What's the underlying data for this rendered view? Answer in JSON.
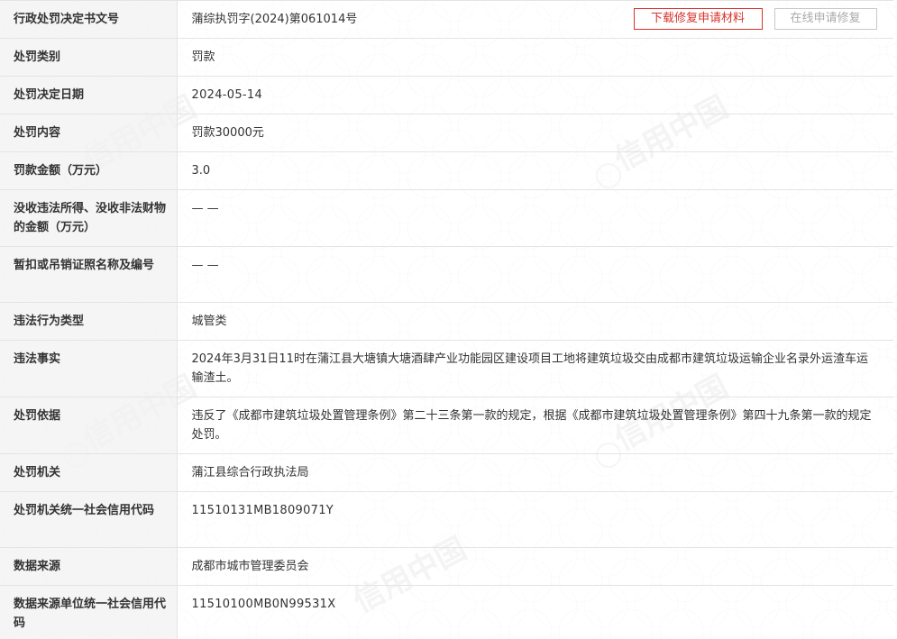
{
  "watermark_text": "信用中国",
  "actions": {
    "download_label": "下载修复申请材料",
    "online_label": "在线申请修复"
  },
  "rows": [
    {
      "label": "行政处罚决定书文号",
      "value": "蒲综执罚字(2024)第061014号"
    },
    {
      "label": "处罚类别",
      "value": "罚款"
    },
    {
      "label": "处罚决定日期",
      "value": "2024-05-14"
    },
    {
      "label": "处罚内容",
      "value": "罚款30000元"
    },
    {
      "label": "罚款金额（万元）",
      "value": "3.0"
    },
    {
      "label": "没收违法所得、没收非法财物的金额（万元）",
      "value": "— —"
    },
    {
      "label": "暂扣或吊销证照名称及编号",
      "value": "— —"
    },
    {
      "label": "违法行为类型",
      "value": "城管类"
    },
    {
      "label": "违法事实",
      "value": "2024年3月31日11时在蒲江县大塘镇大塘酒肆产业功能园区建设项目工地将建筑垃圾交由成都市建筑垃圾运输企业名录外运渣车运输渣土。"
    },
    {
      "label": "处罚依据",
      "value": "违反了《成都市建筑垃圾处置管理条例》第二十三条第一款的规定，根据《成都市建筑垃圾处置管理条例》第四十九条第一款的规定处罚。"
    },
    {
      "label": "处罚机关",
      "value": "蒲江县综合行政执法局"
    },
    {
      "label": "处罚机关统一社会信用代码",
      "value": "11510131MB1809071Y"
    },
    {
      "label": "数据来源",
      "value": "成都市城市管理委员会"
    },
    {
      "label": "数据来源单位统一社会信用代码",
      "value": "11510100MB0N99531X"
    }
  ]
}
